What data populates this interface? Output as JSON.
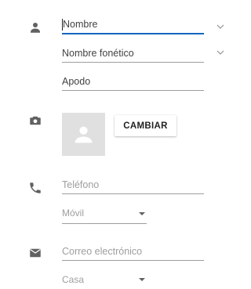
{
  "name_section": {
    "icon": "person-icon",
    "fields": [
      {
        "key": "nombre",
        "label": "Nombre",
        "active": true
      },
      {
        "key": "nombre_fonetico",
        "label": "Nombre fonético"
      },
      {
        "key": "apodo",
        "label": "Apodo"
      }
    ]
  },
  "photo_section": {
    "icon": "camera-icon",
    "avatar_icon": "avatar-placeholder-icon",
    "change_button": "CAMBIAR"
  },
  "phone_section": {
    "icon": "phone-icon",
    "placeholder": "Teléfono",
    "type_value": "Móvil"
  },
  "email_section": {
    "icon": "email-icon",
    "placeholder": "Correo electrónico",
    "type_value": "Casa"
  },
  "colors": {
    "accent": "#1565c0",
    "icon": "#616161",
    "hint": "#9e9e9e",
    "avatar_bg": "#e0e0e0"
  }
}
